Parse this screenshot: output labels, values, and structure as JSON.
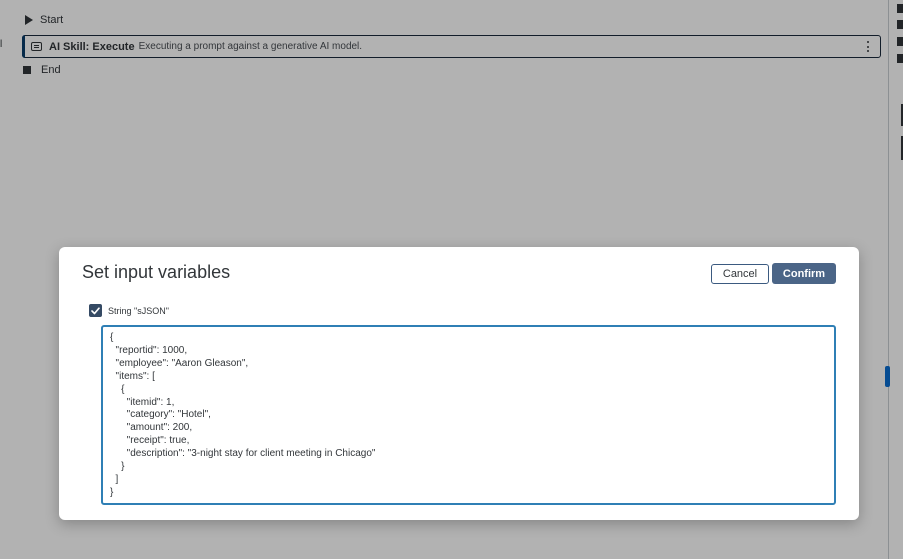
{
  "flow": {
    "left_edge_text": "l",
    "start_label": "Start",
    "step": {
      "title": "AI Skill: Execute",
      "description": "Executing a prompt against a generative AI model."
    },
    "end_label": "End"
  },
  "dialog": {
    "title": "Set input variables",
    "cancel_label": "Cancel",
    "confirm_label": "Confirm",
    "variable": {
      "checked": true,
      "label": "String \"sJSON\"",
      "value": "{\n  \"reportid\": 1000,\n  \"employee\": \"Aaron Gleason\",\n  \"items\": [\n    {\n      \"itemid\": 1,\n      \"category\": \"Hotel\",\n      \"amount\": 200,\n      \"receipt\": true,\n      \"description\": \"3-night stay for client meeting in Chicago\"\n    }\n  ]\n}"
    }
  },
  "colors": {
    "confirm_button": "#4b6587",
    "checkbox": "#354a64",
    "editor_border": "#2f7fb5",
    "step_accent": "#0a3d6b"
  },
  "icons": {
    "start": "play-icon",
    "end": "stop-icon",
    "step": "ai-skill-icon",
    "step_menu": "more-vertical-icon",
    "checkbox": "checkmark-icon"
  }
}
